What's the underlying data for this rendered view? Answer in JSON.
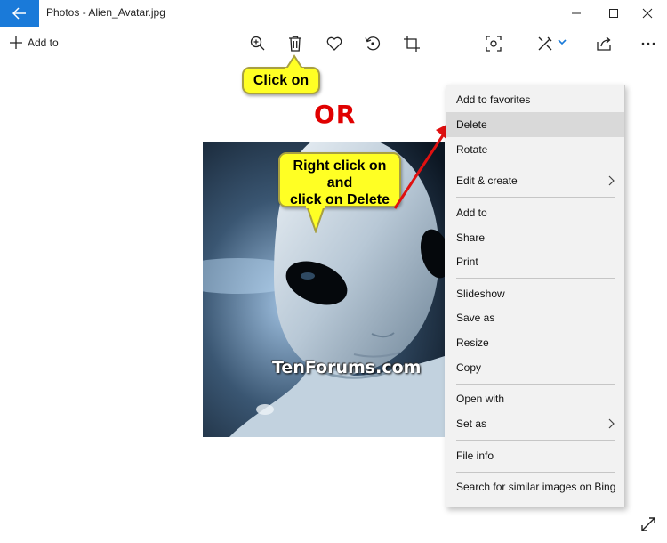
{
  "window": {
    "title": "Photos - Alien_Avatar.jpg",
    "accent_color": "#1a7ad9"
  },
  "toolbar": {
    "add_to_label": "Add to",
    "icons": [
      "plus-icon",
      "zoom-in-icon",
      "delete-icon",
      "favorite-heart-icon",
      "rotate-icon",
      "crop-icon",
      "people-tag-icon",
      "edit-create-icon",
      "share-icon",
      "more-icon"
    ]
  },
  "annotations": {
    "callout_top": "Click on",
    "or_text": "OR",
    "callout_right_lines": [
      "Right click on",
      "and",
      "click on Delete"
    ],
    "callout_color": "#ffff24",
    "or_color": "#e00000"
  },
  "photo": {
    "watermark": "TenForums.com"
  },
  "context_menu": {
    "items": [
      {
        "label": "Add to favorites"
      },
      {
        "label": "Delete",
        "highlighted": true
      },
      {
        "label": "Rotate"
      },
      {
        "label": "Edit & create",
        "submenu": true
      },
      {
        "label": "Add to"
      },
      {
        "label": "Share"
      },
      {
        "label": "Print"
      },
      {
        "label": "Slideshow"
      },
      {
        "label": "Save as"
      },
      {
        "label": "Resize"
      },
      {
        "label": "Copy"
      },
      {
        "label": "Open with"
      },
      {
        "label": "Set as",
        "submenu": true
      },
      {
        "label": "File info"
      },
      {
        "label": "Search for similar images on Bing"
      }
    ]
  }
}
